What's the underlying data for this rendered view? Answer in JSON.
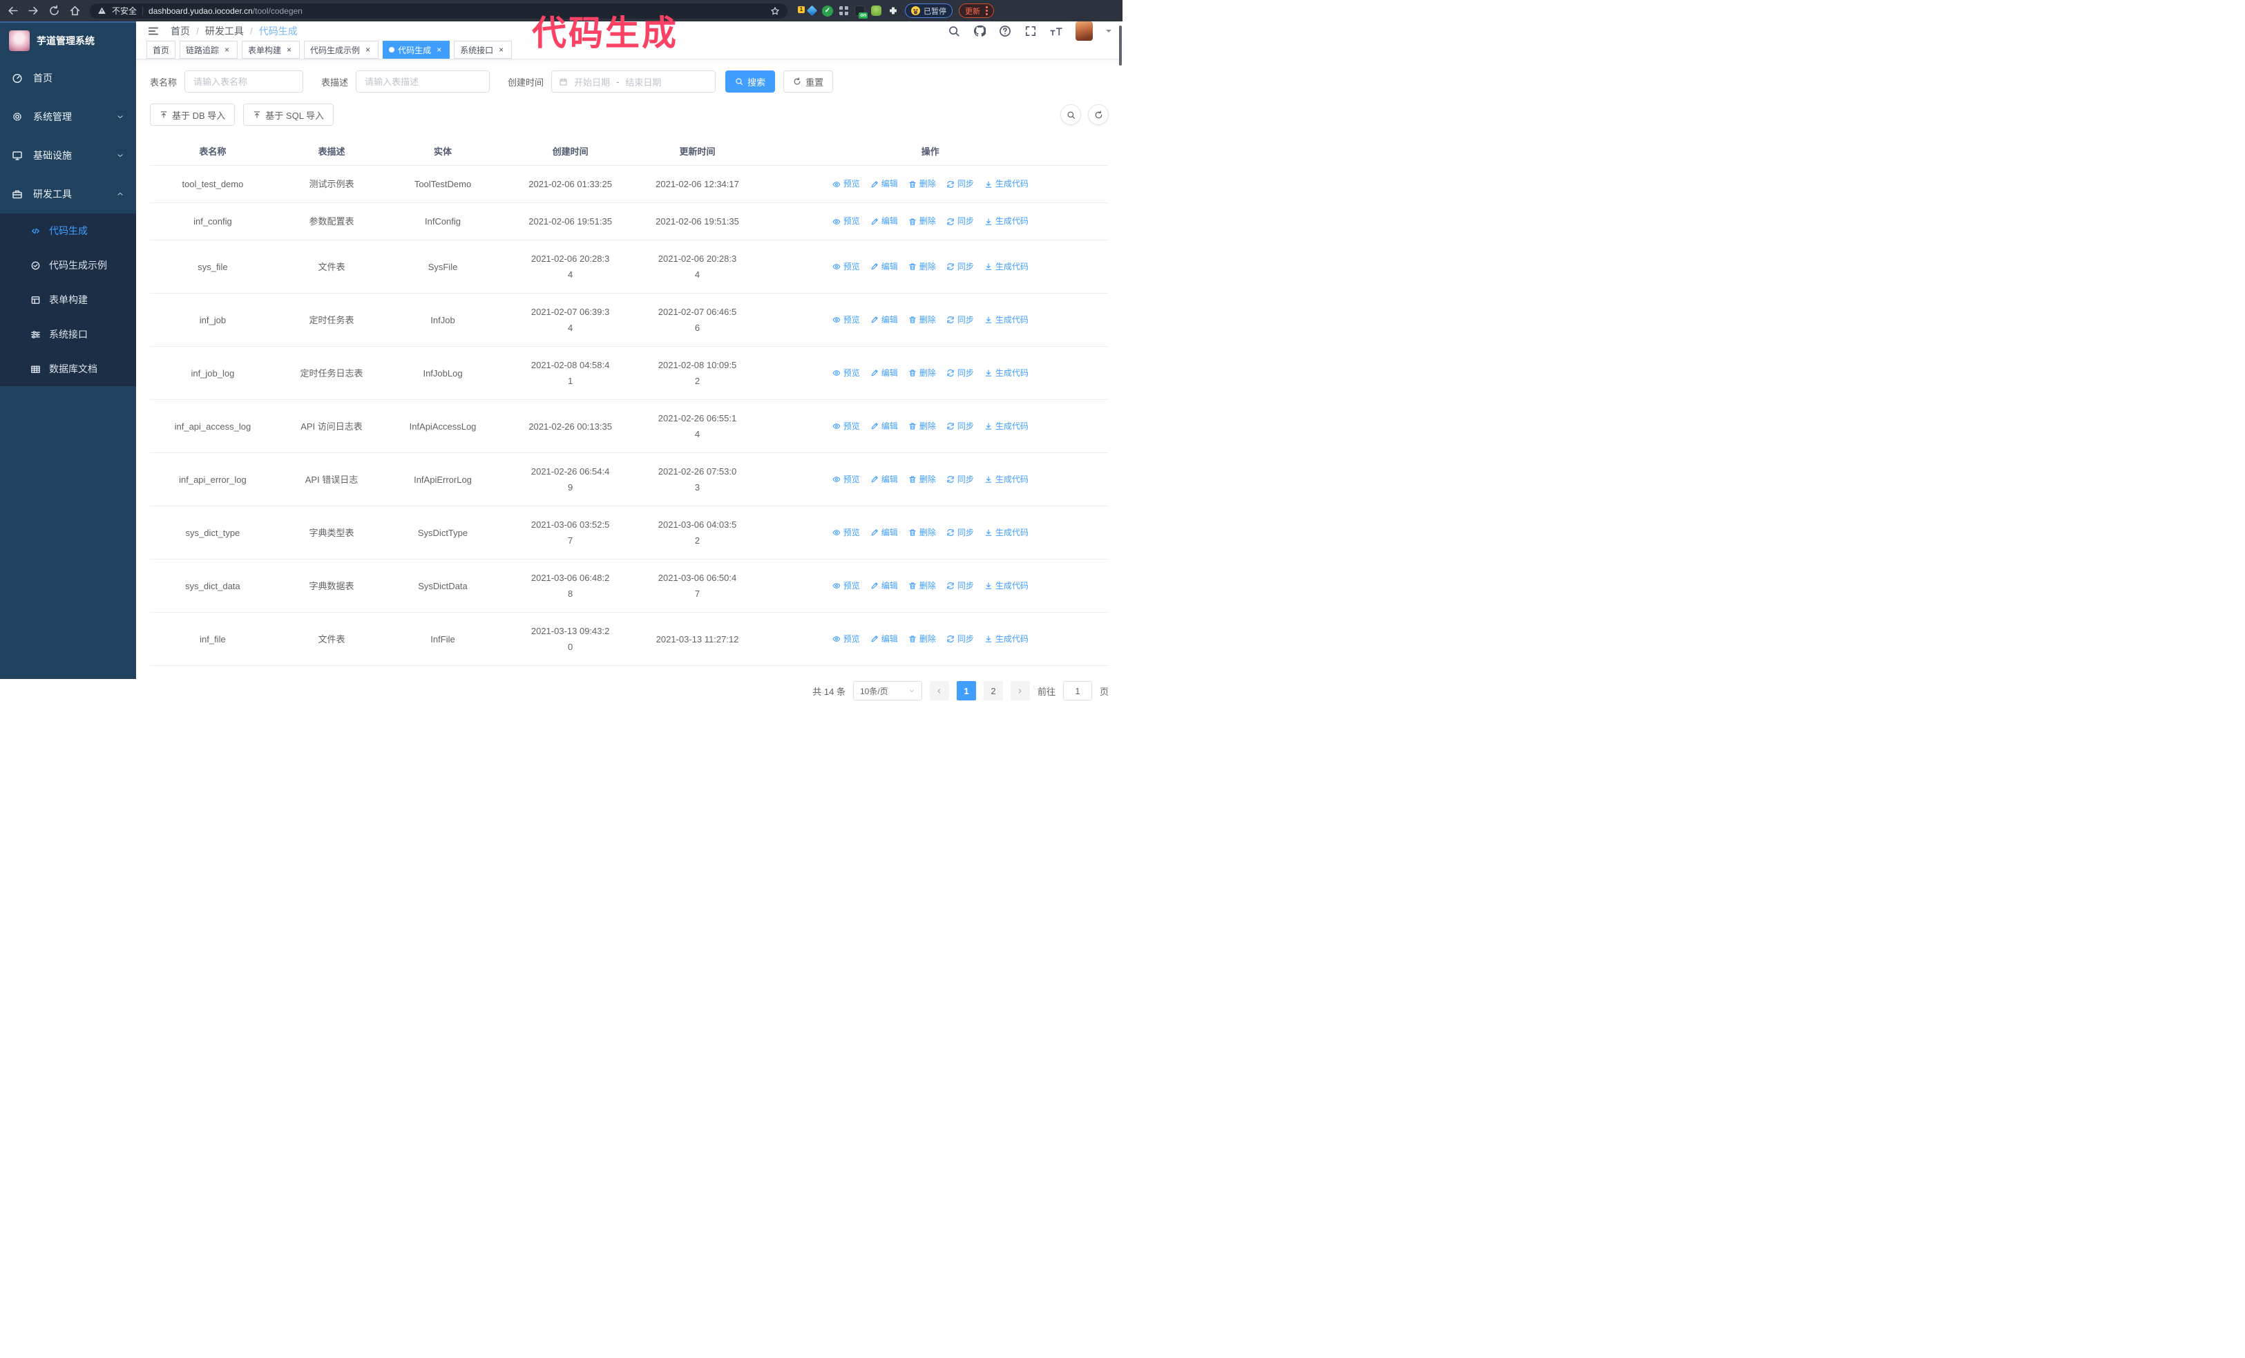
{
  "browser": {
    "security_label": "不安全",
    "url_domain": "dashboard.yudao.iocoder.cn",
    "url_path": "/tool/codegen",
    "extension_badge": "1",
    "on_badge": "on",
    "paused_label": "已暂停",
    "update_label": "更新"
  },
  "annotation": "代码生成",
  "sidebar": {
    "title": "芋道管理系统",
    "items": [
      {
        "label": "首页"
      },
      {
        "label": "系统管理"
      },
      {
        "label": "基础设施"
      },
      {
        "label": "研发工具"
      }
    ],
    "submenu": [
      {
        "label": "代码生成"
      },
      {
        "label": "代码生成示例"
      },
      {
        "label": "表单构建"
      },
      {
        "label": "系统接口"
      },
      {
        "label": "数据库文档"
      }
    ]
  },
  "breadcrumb": {
    "items": [
      "首页",
      "研发工具",
      "代码生成"
    ]
  },
  "tabs": [
    {
      "label": "首页"
    },
    {
      "label": "链路追踪"
    },
    {
      "label": "表单构建"
    },
    {
      "label": "代码生成示例"
    },
    {
      "label": "代码生成"
    },
    {
      "label": "系统接口"
    }
  ],
  "filters": {
    "name_label": "表名称",
    "name_placeholder": "请输入表名称",
    "desc_label": "表描述",
    "desc_placeholder": "请输入表描述",
    "time_label": "创建时间",
    "start_placeholder": "开始日期",
    "range_separator": "-",
    "end_placeholder": "结束日期",
    "search_label": "搜索",
    "reset_label": "重置"
  },
  "toolbar": {
    "db_import_label": "基于 DB 导入",
    "sql_import_label": "基于 SQL 导入"
  },
  "table": {
    "headers": [
      "表名称",
      "表描述",
      "实体",
      "创建时间",
      "更新时间",
      "操作"
    ],
    "action_labels": {
      "preview": "预览",
      "edit": "编辑",
      "delete": "删除",
      "sync": "同步",
      "generate": "生成代码"
    },
    "rows": [
      {
        "name": "tool_test_demo",
        "desc": "测试示例表",
        "entity": "ToolTestDemo",
        "created": "2021-02-06 01:33:25",
        "updated": "2021-02-06 12:34:17"
      },
      {
        "name": "inf_config",
        "desc": "参数配置表",
        "entity": "InfConfig",
        "created": "2021-02-06 19:51:35",
        "updated": "2021-02-06 19:51:35"
      },
      {
        "name": "sys_file",
        "desc": "文件表",
        "entity": "SysFile",
        "created": "2021-02-06 20:28:3\n4",
        "updated": "2021-02-06 20:28:3\n4"
      },
      {
        "name": "inf_job",
        "desc": "定时任务表",
        "entity": "InfJob",
        "created": "2021-02-07 06:39:3\n4",
        "updated": "2021-02-07 06:46:5\n6"
      },
      {
        "name": "inf_job_log",
        "desc": "定时任务日志表",
        "entity": "InfJobLog",
        "created": "2021-02-08 04:58:4\n1",
        "updated": "2021-02-08 10:09:5\n2"
      },
      {
        "name": "inf_api_access_log",
        "desc": "API 访问日志表",
        "entity": "InfApiAccessLog",
        "created": "2021-02-26 00:13:35",
        "updated": "2021-02-26 06:55:1\n4"
      },
      {
        "name": "inf_api_error_log",
        "desc": "API 错误日志",
        "entity": "InfApiErrorLog",
        "created": "2021-02-26 06:54:4\n9",
        "updated": "2021-02-26 07:53:0\n3"
      },
      {
        "name": "sys_dict_type",
        "desc": "字典类型表",
        "entity": "SysDictType",
        "created": "2021-03-06 03:52:5\n7",
        "updated": "2021-03-06 04:03:5\n2"
      },
      {
        "name": "sys_dict_data",
        "desc": "字典数据表",
        "entity": "SysDictData",
        "created": "2021-03-06 06:48:2\n8",
        "updated": "2021-03-06 06:50:4\n7"
      },
      {
        "name": "inf_file",
        "desc": "文件表",
        "entity": "InfFile",
        "created": "2021-03-13 09:43:2\n0",
        "updated": "2021-03-13 11:27:12"
      }
    ]
  },
  "pagination": {
    "total": "共 14 条",
    "page_size": "10条/页",
    "pages": [
      "1",
      "2"
    ],
    "goto_label": "前往",
    "goto_value": "1",
    "page_unit": "页"
  }
}
